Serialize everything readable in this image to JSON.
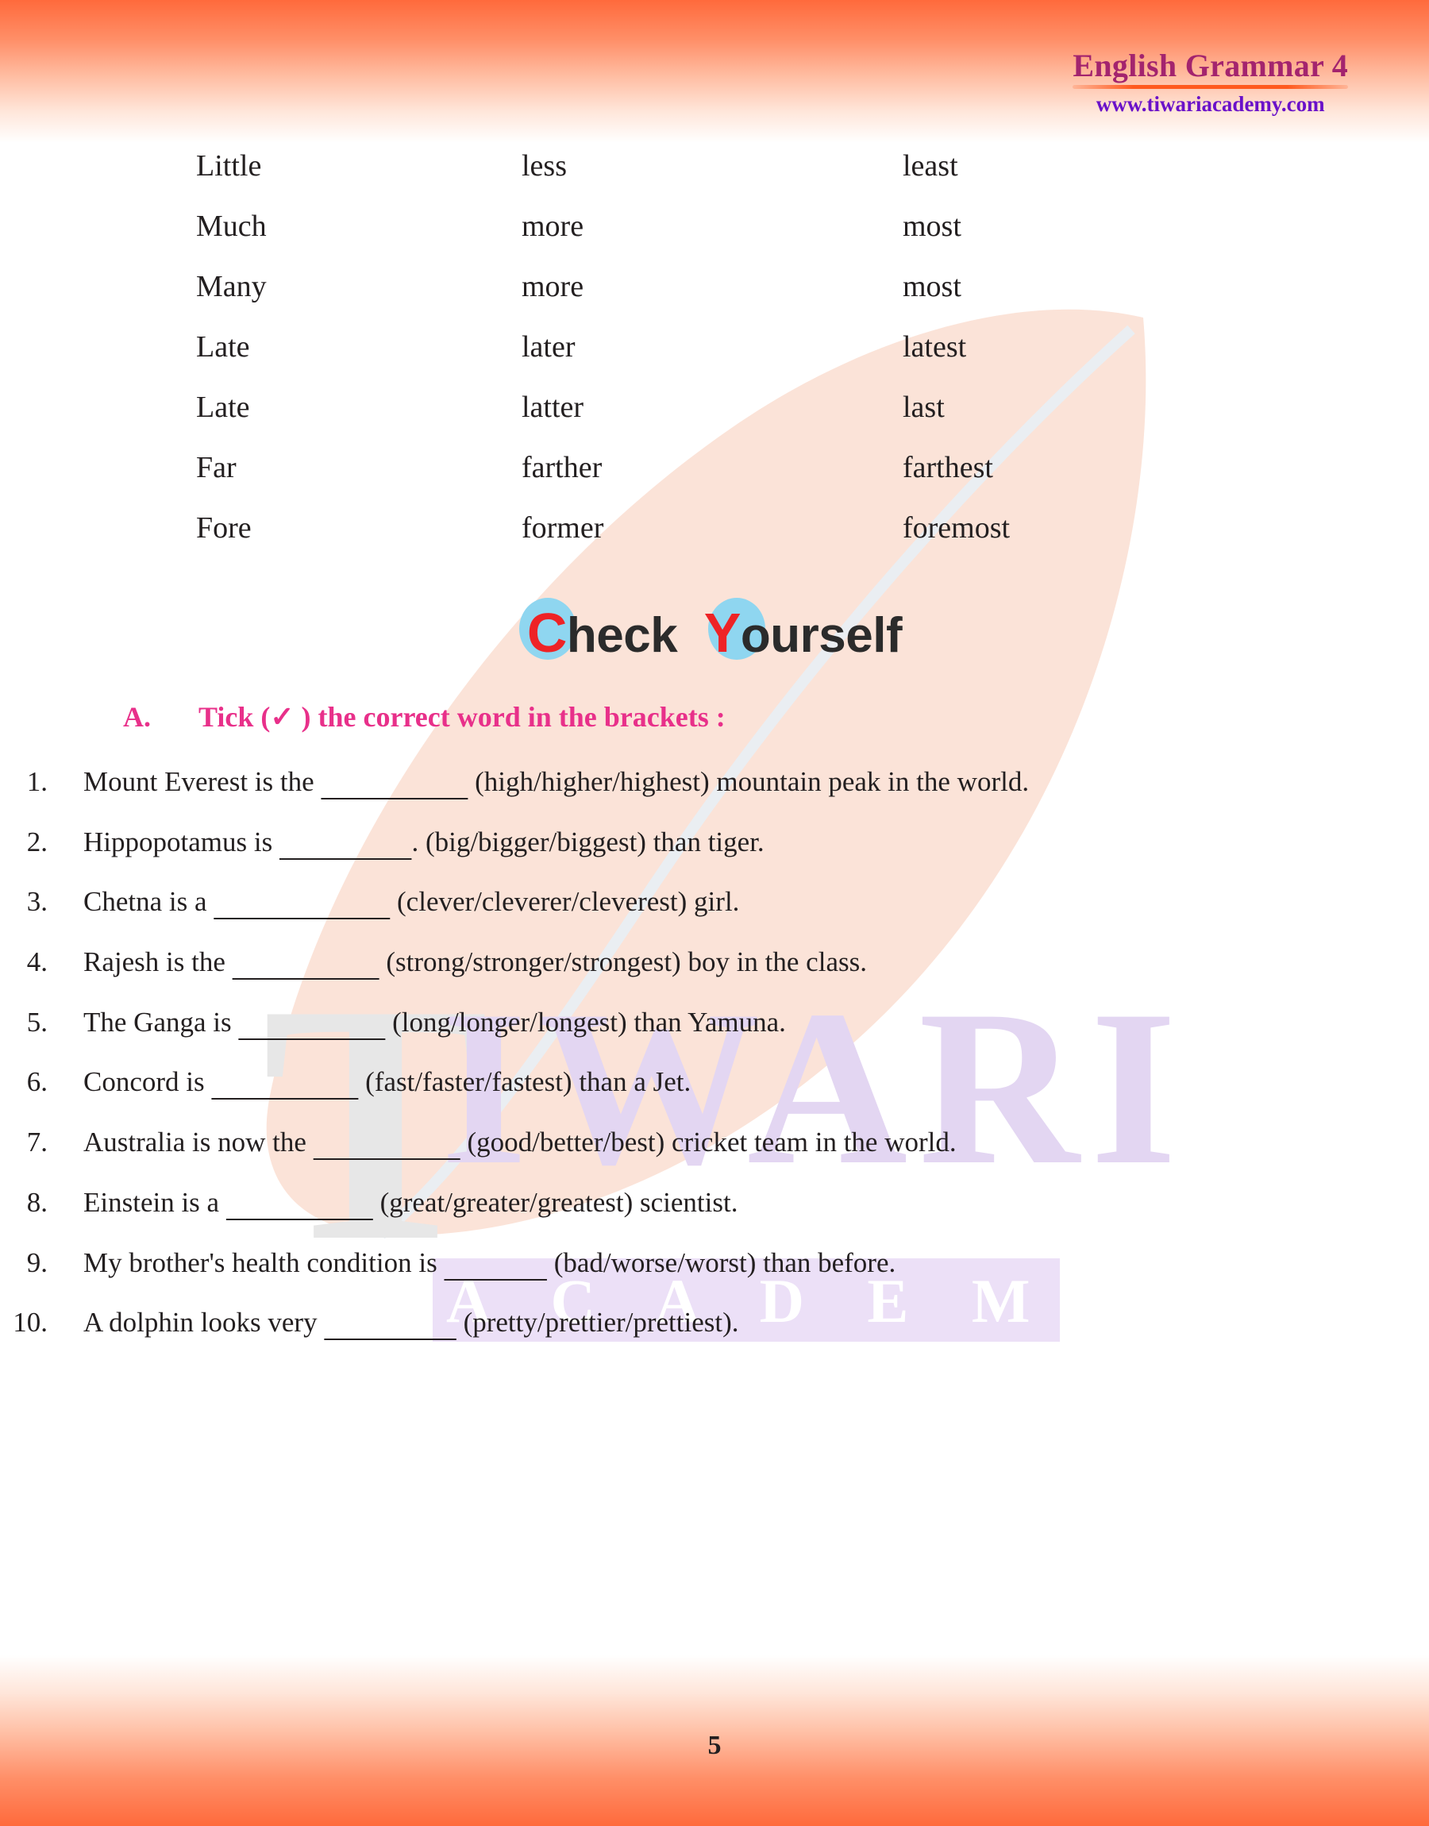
{
  "header": {
    "title": "English Grammar 4",
    "site": "www.tiwariacademy.com"
  },
  "watermark": {
    "letter": "T",
    "word": "IWARI",
    "academy": "A C A D E M Y"
  },
  "degree_table": {
    "rows": [
      {
        "positive": "Little",
        "comparative": "less",
        "superlative": "least"
      },
      {
        "positive": "Much",
        "comparative": "more",
        "superlative": "most"
      },
      {
        "positive": "Many",
        "comparative": "more",
        "superlative": "most"
      },
      {
        "positive": "Late",
        "comparative": "later",
        "superlative": "latest"
      },
      {
        "positive": "Late",
        "comparative": "latter",
        "superlative": "last"
      },
      {
        "positive": "Far",
        "comparative": "farther",
        "superlative": "farthest"
      },
      {
        "positive": "Fore",
        "comparative": "former",
        "superlative": "foremost"
      }
    ]
  },
  "check_yourself": {
    "part1_cap": "C",
    "part1_rest": "heck",
    "part2_cap": "Y",
    "part2_rest": "ourself"
  },
  "section_a": {
    "letter": "A.",
    "heading": "Tick (✓ ) the correct word in the brackets :"
  },
  "questions": [
    {
      "num": "1.",
      "pre": "Mount Everest is the ",
      "blank": "__________",
      "post": " (high/higher/highest) mountain peak in the world.",
      "justify": true
    },
    {
      "num": "2.",
      "pre": "Hippopotamus is ",
      "blank": "_________",
      "post": ". (big/bigger/biggest) than tiger.",
      "justify": false
    },
    {
      "num": "3.",
      "pre": "Chetna is a ",
      "blank": "____________",
      "post": " (clever/cleverer/cleverest) girl.",
      "justify": false
    },
    {
      "num": "4.",
      "pre": "Rajesh is the ",
      "blank": "__________",
      "post": " (strong/stronger/strongest) boy in the class.",
      "justify": true
    },
    {
      "num": "5.",
      "pre": "The Ganga is ",
      "blank": "__________",
      "post": " (long/longer/longest) than Yamuna.",
      "justify": false
    },
    {
      "num": "6.",
      "pre": "Concord is ",
      "blank": "__________",
      "post": " (fast/faster/fastest) than a Jet.",
      "justify": false
    },
    {
      "num": "7.",
      "pre": "Australia is now the ",
      "blank": "__________",
      "post": " (good/better/best) cricket team in the world.",
      "justify": true
    },
    {
      "num": "8.",
      "pre": "Einstein is a ",
      "blank": "__________",
      "post": " (great/greater/greatest) scientist.",
      "justify": false
    },
    {
      "num": "9.",
      "pre": "My brother's health condition is ",
      "blank": "_______",
      "post": " (bad/worse/worst) than before.",
      "justify": true
    },
    {
      "num": "10.",
      "pre": "A dolphin looks very ",
      "blank": "_________",
      "post": " (pretty/prettier/prettiest).",
      "justify": false
    }
  ],
  "footer": {
    "page_number": "5"
  },
  "colors": {
    "band_orange": "#ff6a3c",
    "title_purple": "#a3246e",
    "site_violet": "#6a11c9",
    "section_pink": "#e8308a",
    "accent_red": "#ee2326",
    "accent_blue": "#8fd6f0",
    "leaf_peach": "#fbe3d8",
    "watermark_gray": "#e7e7e7",
    "watermark_violet": "#e3d6f2"
  }
}
